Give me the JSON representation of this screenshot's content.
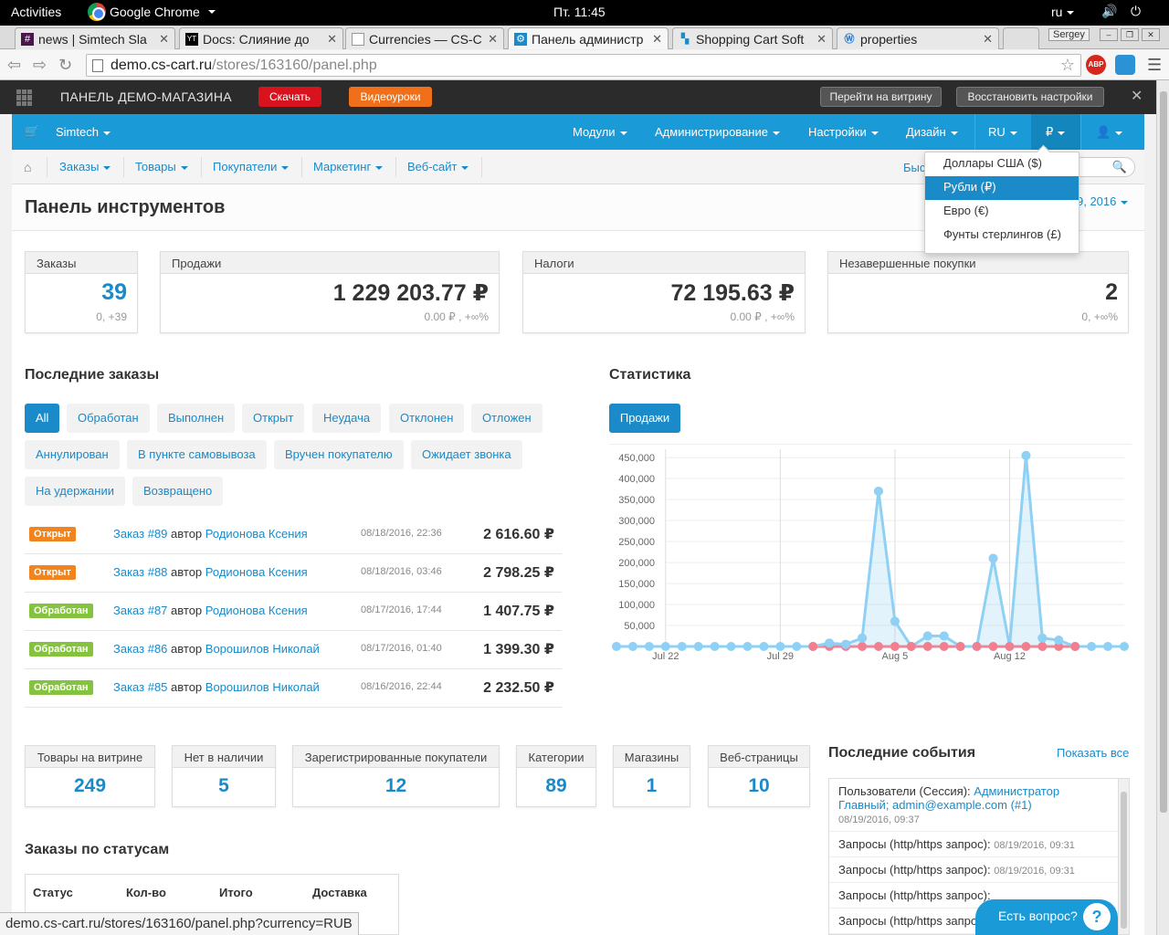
{
  "gnome": {
    "activities": "Activities",
    "app": "Google Chrome",
    "clock": "Пт. 11:45",
    "lang": "ru"
  },
  "tabs": [
    {
      "label": "news | Simtech Sla",
      "icon": "#"
    },
    {
      "label": "Docs: Слияние до",
      "icon": "YT"
    },
    {
      "label": "Currencies — CS-C",
      "icon": ""
    },
    {
      "label": "Панель администр",
      "icon": ""
    },
    {
      "label": "Shopping Cart Soft",
      "icon": ""
    },
    {
      "label": "properties",
      "icon": ""
    }
  ],
  "browser": {
    "user": "Sergey",
    "url_host": "demo.cs-cart.ru",
    "url_path": "/stores/163160/panel.php",
    "abp": "ABP"
  },
  "demobar": {
    "title": "ПАНЕЛЬ ДЕМО-МАГАЗИНА",
    "download": "Скачать",
    "videos": "Видеоуроки",
    "storefront": "Перейти на витрину",
    "restore": "Восстановить настройки"
  },
  "topnav": {
    "store": "Simtech",
    "modules": "Модули",
    "admin": "Администрирование",
    "settings": "Настройки",
    "design": "Дизайн",
    "lang": "RU",
    "currency": "₽"
  },
  "subnav": {
    "orders": "Заказы",
    "products": "Товары",
    "customers": "Покупатели",
    "marketing": "Маркетинг",
    "website": "Веб-сайт",
    "truncated": "Быс"
  },
  "currency_menu": [
    {
      "label": "Доллары США ($)",
      "selected": false
    },
    {
      "label": "Рубли (₽)",
      "selected": true
    },
    {
      "label": "Евро (€)",
      "selected": false
    },
    {
      "label": "Фунты стерлингов (£)",
      "selected": false
    }
  ],
  "page": {
    "title": "Панель инструментов",
    "date_fragment": "9, 2016"
  },
  "kpis": {
    "orders": {
      "label": "Заказы",
      "value": "39",
      "sub": "0, +39"
    },
    "sales": {
      "label": "Продажи",
      "value": "1 229 203.77 ₽",
      "sub": "0.00 ₽ , +∞%"
    },
    "taxes": {
      "label": "Налоги",
      "value": "72 195.63 ₽",
      "sub": "0.00 ₽ , +∞%"
    },
    "abandoned": {
      "label": "Незавершенные покупки",
      "value": "2",
      "sub": "0, +∞%"
    }
  },
  "recent_orders": {
    "title": "Последние заказы",
    "filters": [
      "All",
      "Обработан",
      "Выполнен",
      "Открыт",
      "Неудача",
      "Отклонен",
      "Отложен",
      "Аннулирован",
      "В пункте самовывоза",
      "Вручен покупателю",
      "Ожидает звонка",
      "На удержании",
      "Возвращено"
    ],
    "by": "автор",
    "rows": [
      {
        "status": "Открыт",
        "status_color": "#f0841e",
        "order": "Заказ #89",
        "customer": "Родионова Ксения",
        "date": "08/18/2016, 22:36",
        "amount": "2 616.60 ₽"
      },
      {
        "status": "Открыт",
        "status_color": "#f0841e",
        "order": "Заказ #88",
        "customer": "Родионова Ксения",
        "date": "08/18/2016, 03:46",
        "amount": "2 798.25 ₽"
      },
      {
        "status": "Обработан",
        "status_color": "#85c33f",
        "order": "Заказ #87",
        "customer": "Родионова Ксения",
        "date": "08/17/2016, 17:44",
        "amount": "1 407.75 ₽"
      },
      {
        "status": "Обработан",
        "status_color": "#85c33f",
        "order": "Заказ #86",
        "customer": "Ворошилов Николай",
        "date": "08/17/2016, 01:40",
        "amount": "1 399.30 ₽"
      },
      {
        "status": "Обработан",
        "status_color": "#85c33f",
        "order": "Заказ #85",
        "customer": "Ворошилов Николай",
        "date": "08/16/2016, 22:44",
        "amount": "2 232.50 ₽"
      }
    ]
  },
  "statistics": {
    "title": "Статистика",
    "tab": "Продажи"
  },
  "chart_data": {
    "type": "area",
    "y_ticks": [
      "450,000",
      "400,000",
      "350,000",
      "300,000",
      "250,000",
      "200,000",
      "150,000",
      "100,000",
      "50,000"
    ],
    "x_ticks": [
      "Jul 22",
      "Jul 29",
      "Aug 5",
      "Aug 12"
    ],
    "ylim": [
      0,
      470000
    ],
    "grid": true,
    "series": [
      {
        "color": "#8fd0f5",
        "values": [
          0,
          0,
          0,
          0,
          0,
          0,
          0,
          0,
          0,
          0,
          0,
          0,
          0,
          8000,
          5000,
          20000,
          370000,
          60000,
          0,
          25000,
          25000,
          0,
          0,
          210000,
          0,
          455000,
          20000,
          15000,
          0,
          0,
          0,
          0
        ]
      },
      {
        "color": "#f27f8f",
        "values": [
          0,
          0,
          0,
          0,
          0,
          0,
          0,
          0,
          0,
          0,
          0,
          0,
          0,
          0,
          0,
          0,
          0,
          0,
          0,
          0,
          0,
          0,
          0,
          0,
          0,
          0,
          0,
          0,
          0,
          0,
          0,
          0
        ]
      }
    ]
  },
  "stats_boxes": [
    {
      "label": "Товары на витрине",
      "value": "249"
    },
    {
      "label": "Нет в наличии",
      "value": "5"
    },
    {
      "label": "Зарегистрированные покупатели",
      "value": "12"
    },
    {
      "label": "Категории",
      "value": "89"
    },
    {
      "label": "Магазины",
      "value": "1"
    },
    {
      "label": "Веб-страницы",
      "value": "10"
    }
  ],
  "events": {
    "title": "Последние события",
    "show_all": "Показать все",
    "first": {
      "prefix": "Пользователи (Сессия):",
      "link": "Администратор Главный; admin@example.com (#1)",
      "date": "08/19/2016, 09:37"
    },
    "items": [
      {
        "text": "Запросы (http/https запрос):",
        "date": "08/19/2016, 09:31"
      },
      {
        "text": "Запросы (http/https запрос):",
        "date": "08/19/2016, 09:31"
      },
      {
        "text": "Запросы (http/https запрос):",
        "date": ""
      },
      {
        "text": "Запросы (http/https запрос):",
        "date": ""
      }
    ]
  },
  "order_statuses": {
    "title": "Заказы по статусам",
    "columns": [
      "Статус",
      "Кол-во",
      "Итого",
      "Доставка"
    ]
  },
  "statusbar_url": "demo.cs-cart.ru/stores/163160/panel.php?currency=RUB",
  "help": {
    "label": "Есть вопрос?",
    "icon": "?"
  }
}
